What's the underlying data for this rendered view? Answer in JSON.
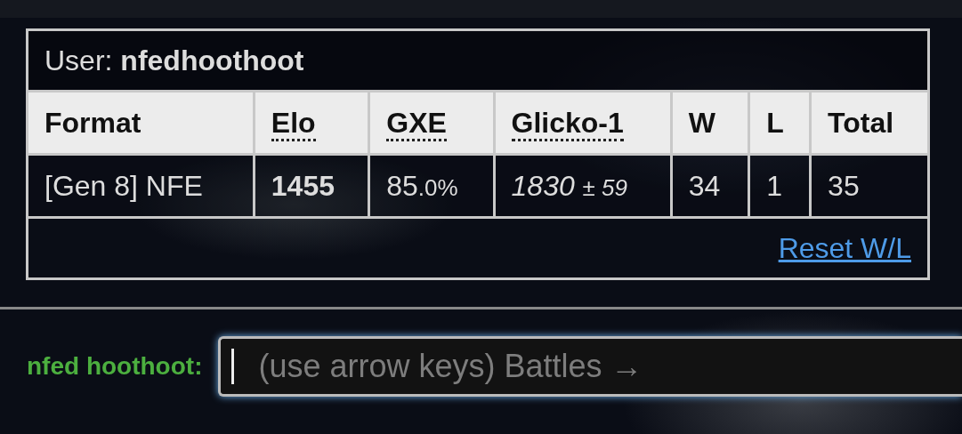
{
  "user_line": "User: **nfedhoothoot**",
  "columns": [
    {
      "label": "Format",
      "abbr": false
    },
    {
      "label": "Elo",
      "abbr": true
    },
    {
      "label": "GXE",
      "abbr": true
    },
    {
      "label": "Glicko-1",
      "abbr": true
    },
    {
      "label": "W",
      "abbr": false
    },
    {
      "label": "L",
      "abbr": false
    },
    {
      "label": "Total",
      "abbr": false
    }
  ],
  "row": {
    "format": "[Gen 8] NFE",
    "elo": "1455",
    "gxe_main": "85",
    "gxe_fraction": ".0%",
    "glicko_rating": "1830",
    "glicko_deviation": "± 59",
    "w": "34",
    "l": "1",
    "total": "35"
  },
  "reset_link": "Reset W/L",
  "chat": {
    "name": "nfed hoothoot:",
    "placeholder": "(use arrow keys) Battles →"
  }
}
